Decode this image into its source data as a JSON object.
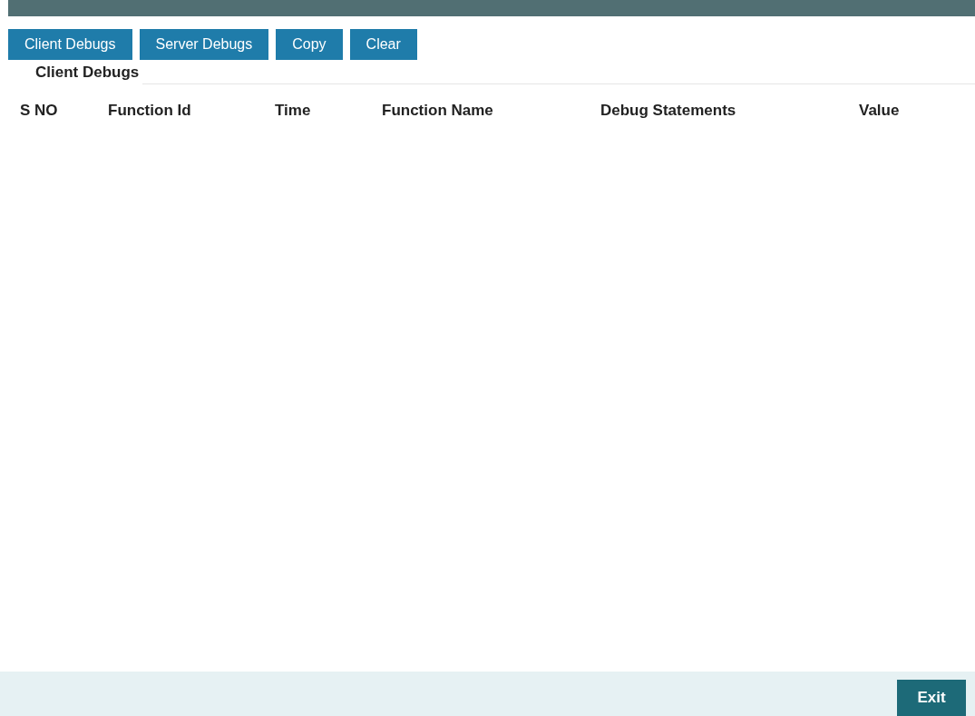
{
  "toolbar": {
    "buttons": [
      "Client Debugs",
      "Server Debugs",
      "Copy",
      "Clear"
    ]
  },
  "section": {
    "title": "Client Debugs"
  },
  "table": {
    "columns": [
      "S NO",
      "Function Id",
      "Time",
      "Function Name",
      "Debug Statements",
      "Value"
    ]
  },
  "footer": {
    "buttons": [
      "Exit"
    ]
  }
}
